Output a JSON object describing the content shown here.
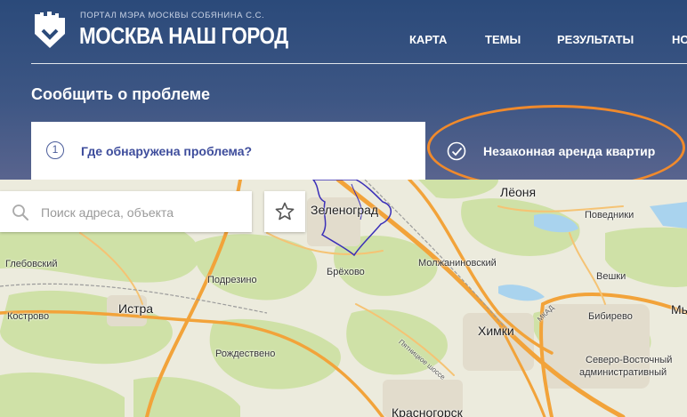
{
  "header": {
    "portal_subtitle": "ПОРТАЛ МЭРА МОСКВЫ СОБЯНИНА С.С.",
    "portal_title": "МОСКВА НАШ ГОРОД",
    "nav": [
      "КАРТА",
      "ТЕМЫ",
      "РЕЗУЛЬТАТЫ",
      "НО"
    ]
  },
  "page": {
    "title": "Сообщить о проблеме",
    "step_number": "1",
    "step_label": "Где обнаружена проблема?",
    "category_label": "Незаконная аренда квартир",
    "highlight_color": "#f08a2c"
  },
  "search": {
    "placeholder": "Поиск адреса, объекта"
  },
  "map": {
    "labels": {
      "zelenograd": "Зеленоград",
      "lyonya": "Лёоня",
      "povedniki": "Поведники",
      "glebovsky": "Глебовский",
      "molzhaninovsky": "Молжаниновский",
      "brekhovo": "Брёхово",
      "podrezino": "Подрезино",
      "vashki": "Вешки",
      "kostrovo": "Кострово",
      "istra": "Истра",
      "bibirevo": "Бибирево",
      "mkad": "МКАД",
      "khimki": "Химки",
      "pyatnitskoe": "Пятницкое шоссе",
      "rozhdestveno": "Рождествено",
      "mya": "Мь",
      "severo_vostochny": "Северо-Восточный",
      "admin_okrug": "административный",
      "krasnogorsk": "Красногорск"
    }
  }
}
